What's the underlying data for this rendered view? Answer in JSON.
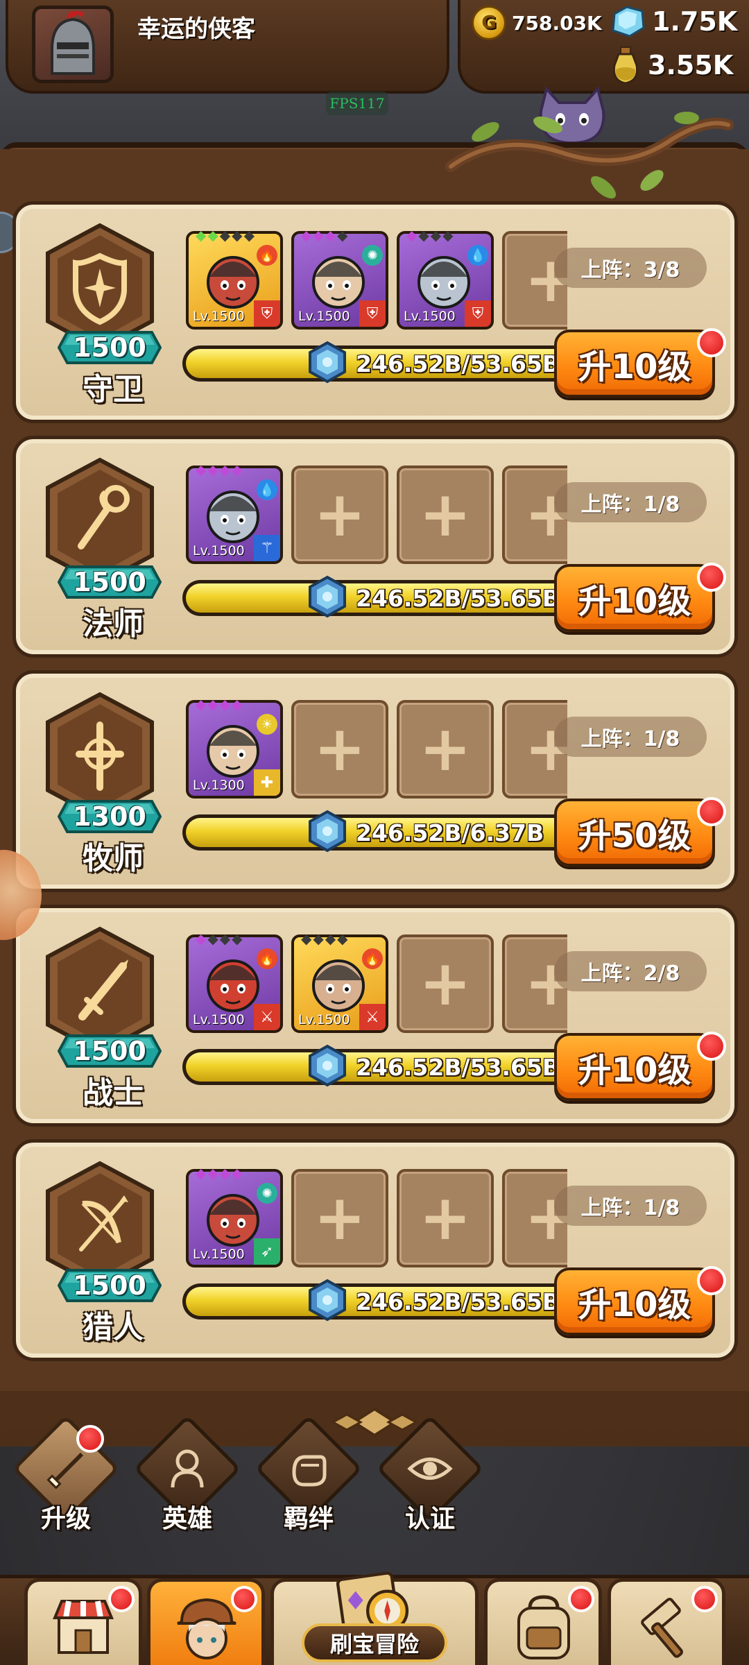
{
  "player": {
    "name": "幸运的侠客"
  },
  "resources": {
    "gold": "758.03K",
    "gem": "1.75K",
    "potion": "3.55K"
  },
  "fps": "FPS117",
  "classes": [
    {
      "name": "守卫",
      "level": "1500",
      "deploy": "上阵：3/8",
      "xp": "246.52B/53.65B",
      "upgrade": "升10级",
      "heroes": [
        {
          "lv": "Lv.1500",
          "frame": "gold",
          "stars": [
            "green",
            "green",
            "dark",
            "dark",
            "dark"
          ],
          "face": "hero-red-mask-icon",
          "element": "fire",
          "role": "shield"
        },
        {
          "lv": "Lv.1500",
          "frame": "purple",
          "stars": [
            "purple",
            "purple",
            "purple",
            "dark"
          ],
          "face": "hero-ninja-icon",
          "element": "wind",
          "role": "shield"
        },
        {
          "lv": "Lv.1500",
          "frame": "purple",
          "stars": [
            "purple",
            "dark",
            "dark",
            "dark"
          ],
          "face": "hero-ice-golem-icon",
          "element": "water",
          "role": "shield"
        }
      ],
      "empty_slots": 1
    },
    {
      "name": "法师",
      "level": "1500",
      "deploy": "上阵：1/8",
      "xp": "246.52B/53.65B",
      "upgrade": "升10级",
      "heroes": [
        {
          "lv": "Lv.1500",
          "frame": "purple",
          "stars": [
            "purple",
            "purple",
            "purple",
            "purple"
          ],
          "face": "hero-mage-girl-icon",
          "element": "water",
          "role": "staff"
        }
      ],
      "empty_slots": 3
    },
    {
      "name": "牧师",
      "level": "1300",
      "deploy": "上阵：1/8",
      "xp": "246.52B/6.37B",
      "upgrade": "升50级",
      "heroes": [
        {
          "lv": "Lv.1300",
          "frame": "purple",
          "stars": [
            "purple",
            "purple",
            "purple",
            "purple"
          ],
          "face": "hero-king-icon",
          "element": "light",
          "role": "cross"
        }
      ],
      "empty_slots": 3
    },
    {
      "name": "战士",
      "level": "1500",
      "deploy": "上阵：2/8",
      "xp": "246.52B/53.65B",
      "upgrade": "升10级",
      "heroes": [
        {
          "lv": "Lv.1500",
          "frame": "purple",
          "stars": [
            "purple",
            "dark",
            "dark",
            "dark"
          ],
          "face": "hero-turban-icon",
          "element": "fire",
          "role": "sword"
        },
        {
          "lv": "Lv.1500",
          "frame": "gold",
          "stars": [
            "dark",
            "dark",
            "dark",
            "dark"
          ],
          "face": "hero-red-demon-icon",
          "element": "fire",
          "role": "sword"
        }
      ],
      "empty_slots": 2
    },
    {
      "name": "猎人",
      "level": "1500",
      "deploy": "上阵：1/8",
      "xp": "246.52B/53.65B",
      "upgrade": "升10级",
      "heroes": [
        {
          "lv": "Lv.1500",
          "frame": "purple",
          "stars": [
            "purple",
            "purple",
            "purple",
            "purple"
          ],
          "face": "hero-elf-archer-icon",
          "element": "wind",
          "role": "bow"
        }
      ],
      "empty_slots": 3
    }
  ],
  "tabs": [
    {
      "label": "升级",
      "icon": "upgrade-sword-icon",
      "active": true,
      "badge": true
    },
    {
      "label": "英雄",
      "icon": "hero-silhouette-icon",
      "active": false,
      "badge": false
    },
    {
      "label": "羁绊",
      "icon": "fist-bond-icon",
      "active": false,
      "badge": false
    },
    {
      "label": "认证",
      "icon": "eye-certify-icon",
      "active": false,
      "badge": false
    }
  ],
  "bottom_nav": {
    "shop_icon": "shop-stall-icon",
    "heroes_icon": "hero-portrait-icon",
    "adventure_label": "刷宝冒险",
    "adventure_icon": "treasure-map-compass-icon",
    "bag_icon": "backpack-icon",
    "forge_icon": "forge-hammer-icon"
  },
  "colors": {
    "upgrade_button": "#ff8a12",
    "xp_bar": "#f1d22a",
    "card_bg": "#e9d7b4",
    "frame_wood": "#5a3820",
    "badge_red": "#d91414",
    "level_teal": "#1fa39f"
  }
}
